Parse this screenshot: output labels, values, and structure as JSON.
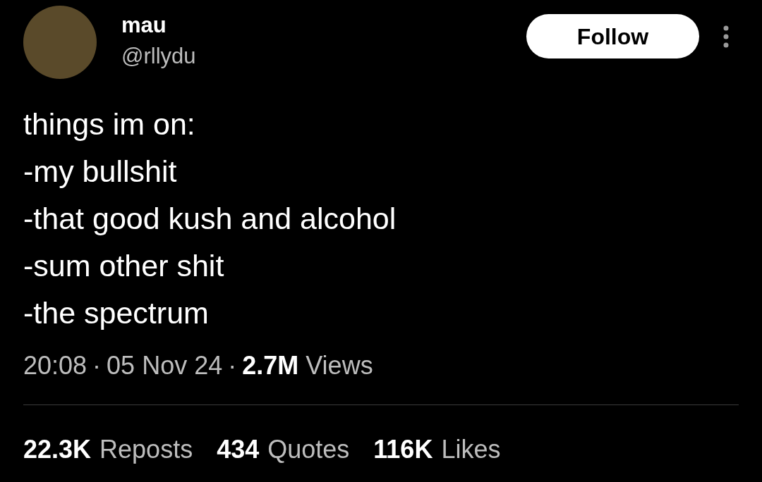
{
  "author": {
    "name": "mau",
    "handle": "@rllydu"
  },
  "follow_button": {
    "label": "Follow"
  },
  "tweet": {
    "lines": [
      "things im on:",
      "-my bullshit",
      "-that good kush and alcohol",
      "-sum other shit",
      "-the spectrum"
    ]
  },
  "meta": {
    "time": "20:08",
    "separator": "·",
    "date": "05 Nov 24",
    "views_count": "2.7M",
    "views_label": "Views"
  },
  "stats": [
    {
      "count": "22.3K",
      "label": "Reposts"
    },
    {
      "count": "434",
      "label": "Quotes"
    },
    {
      "count": "116K",
      "label": "Likes"
    }
  ]
}
